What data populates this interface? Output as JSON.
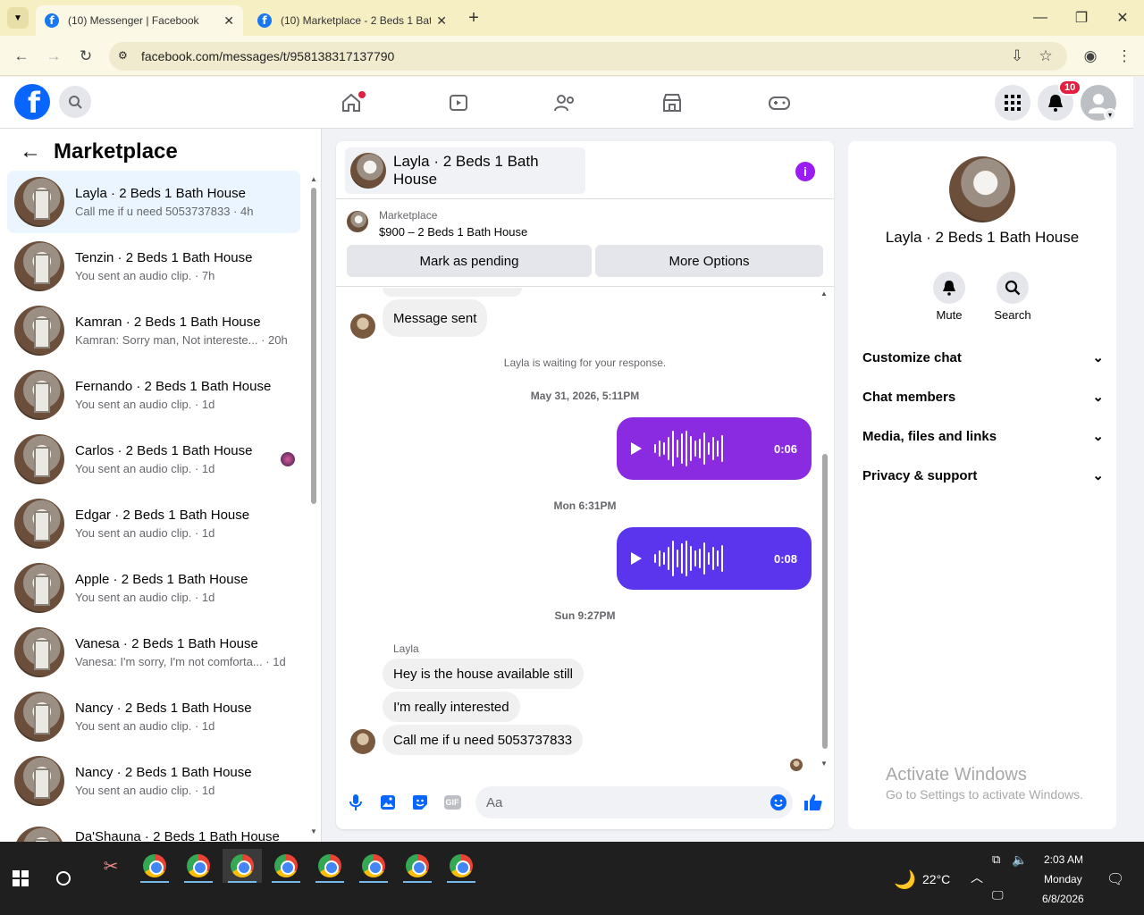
{
  "browser": {
    "tabs": [
      {
        "title": "(10) Messenger | Facebook",
        "active": true
      },
      {
        "title": "(10) Marketplace - 2 Beds 1 Bat",
        "active": false
      }
    ],
    "url": "facebook.com/messages/t/958138317137790"
  },
  "header": {
    "notifications_count": "10"
  },
  "left": {
    "title": "Marketplace",
    "conversations": [
      {
        "name": "Layla · 2 Beds 1 Bath House",
        "preview": "Call me if u need 5053737833 · 4h",
        "selected": true
      },
      {
        "name": "Tenzin · 2 Beds 1 Bath House",
        "preview": "You sent an audio clip. · 7h"
      },
      {
        "name": "Kamran · 2 Beds 1 Bath House",
        "preview": "Kamran: Sorry man, Not intereste... · 20h"
      },
      {
        "name": "Fernando · 2 Beds 1 Bath House",
        "preview": "You sent an audio clip. · 1d"
      },
      {
        "name": "Carlos · 2 Beds 1 Bath House",
        "preview": "You sent an audio clip. · 1d"
      },
      {
        "name": "Edgar · 2 Beds 1 Bath House",
        "preview": "You sent an audio clip. · 1d"
      },
      {
        "name": "Apple · 2 Beds 1 Bath House",
        "preview": "You sent an audio clip. · 1d"
      },
      {
        "name": "Vanesa · 2 Beds 1 Bath House",
        "preview": "Vanesa: I'm sorry, I'm not comforta... · 1d"
      },
      {
        "name": "Nancy · 2 Beds 1 Bath House",
        "preview": "You sent an audio clip. · 1d"
      },
      {
        "name": "Nancy · 2 Beds 1 Bath House",
        "preview": "You sent an audio clip. · 1d"
      },
      {
        "name": "Da'Shauna · 2 Beds 1 Bath House",
        "preview": ""
      }
    ]
  },
  "chat": {
    "title": "Layla · 2 Beds 1 Bath House",
    "listing_source": "Marketplace",
    "listing_title": "$900 – 2 Beds 1 Bath House",
    "mark_pending": "Mark as pending",
    "more_options": "More Options",
    "message_sent": "Message sent",
    "waiting_note": "Layla is waiting for your response.",
    "stamp1": "May 31, 2026, 5:11PM",
    "audio1_duration": "0:06",
    "stamp2": "Mon 6:31PM",
    "audio2_duration": "0:08",
    "stamp3": "Sun 9:27PM",
    "sender": "Layla",
    "messages": [
      "Hey is the house available still",
      "I'm really interested",
      "Call me if u need 5053737833"
    ],
    "composer_placeholder": "Aa",
    "colors": {
      "audio1": "#8a2be2",
      "audio2": "#5b35ee",
      "accent": "#0866ff"
    }
  },
  "right": {
    "name": "Layla · 2 Beds 1 Bath House",
    "mute": "Mute",
    "search": "Search",
    "sections": [
      "Customize chat",
      "Chat members",
      "Media, files and links",
      "Privacy & support"
    ],
    "watermark_title": "Activate Windows",
    "watermark_sub": "Go to Settings to activate Windows."
  },
  "taskbar": {
    "weather": "22°C",
    "time": "2:03 AM",
    "day": "Monday",
    "date": "6/8/2026"
  }
}
